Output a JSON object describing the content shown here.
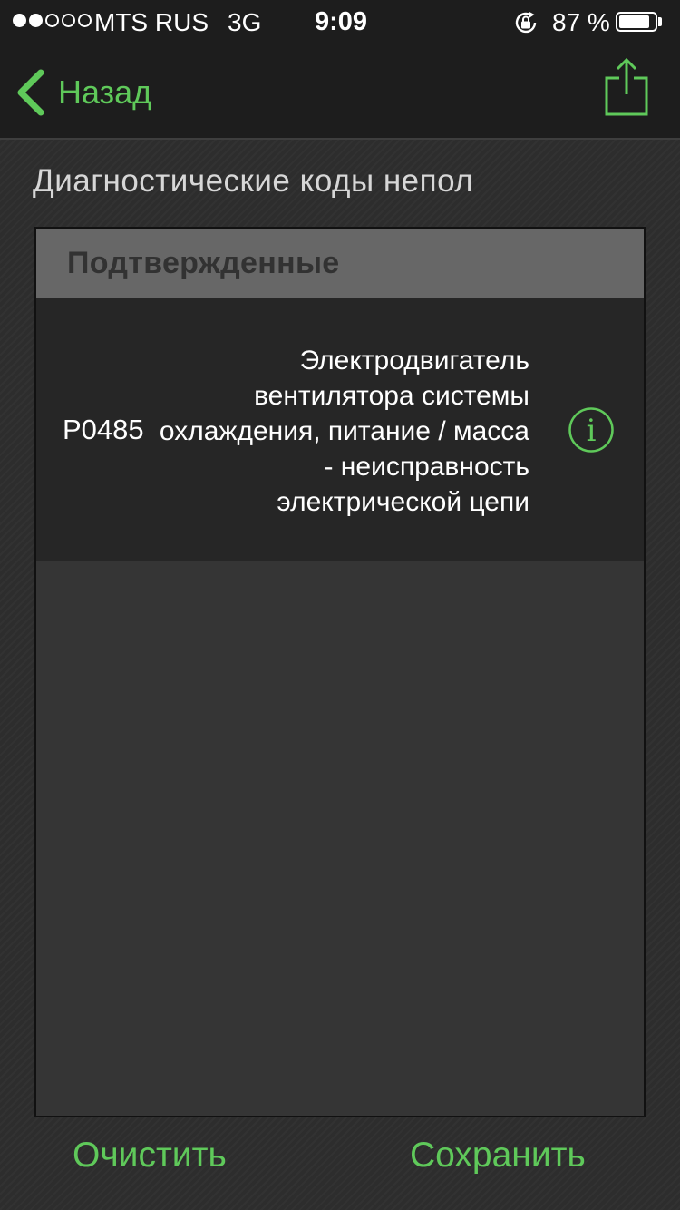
{
  "status_bar": {
    "carrier": "MTS RUS",
    "network": "3G",
    "time": "9:09",
    "battery_percent": "87 %",
    "battery_level": 0.87,
    "signal_bars_filled": 2,
    "signal_bars_total": 5
  },
  "nav": {
    "back_label": "Назад",
    "back_icon": "chevron-left-icon",
    "share_icon": "share-icon"
  },
  "section_title": "Диагностические коды непол",
  "panel": {
    "header": "Подтвержденные",
    "codes": [
      {
        "code": "P0485",
        "description": "Электродвигатель вентилятора системы охлаждения, питание / масса - неисправность электрической цепи",
        "info_icon": "info-icon"
      }
    ]
  },
  "actions": {
    "clear_label": "Очистить",
    "save_label": "Сохранить"
  },
  "colors": {
    "accent": "#5fc95a",
    "bar_background": "#1d1d1d",
    "panel_header": "#676767",
    "row_background": "#262626"
  }
}
